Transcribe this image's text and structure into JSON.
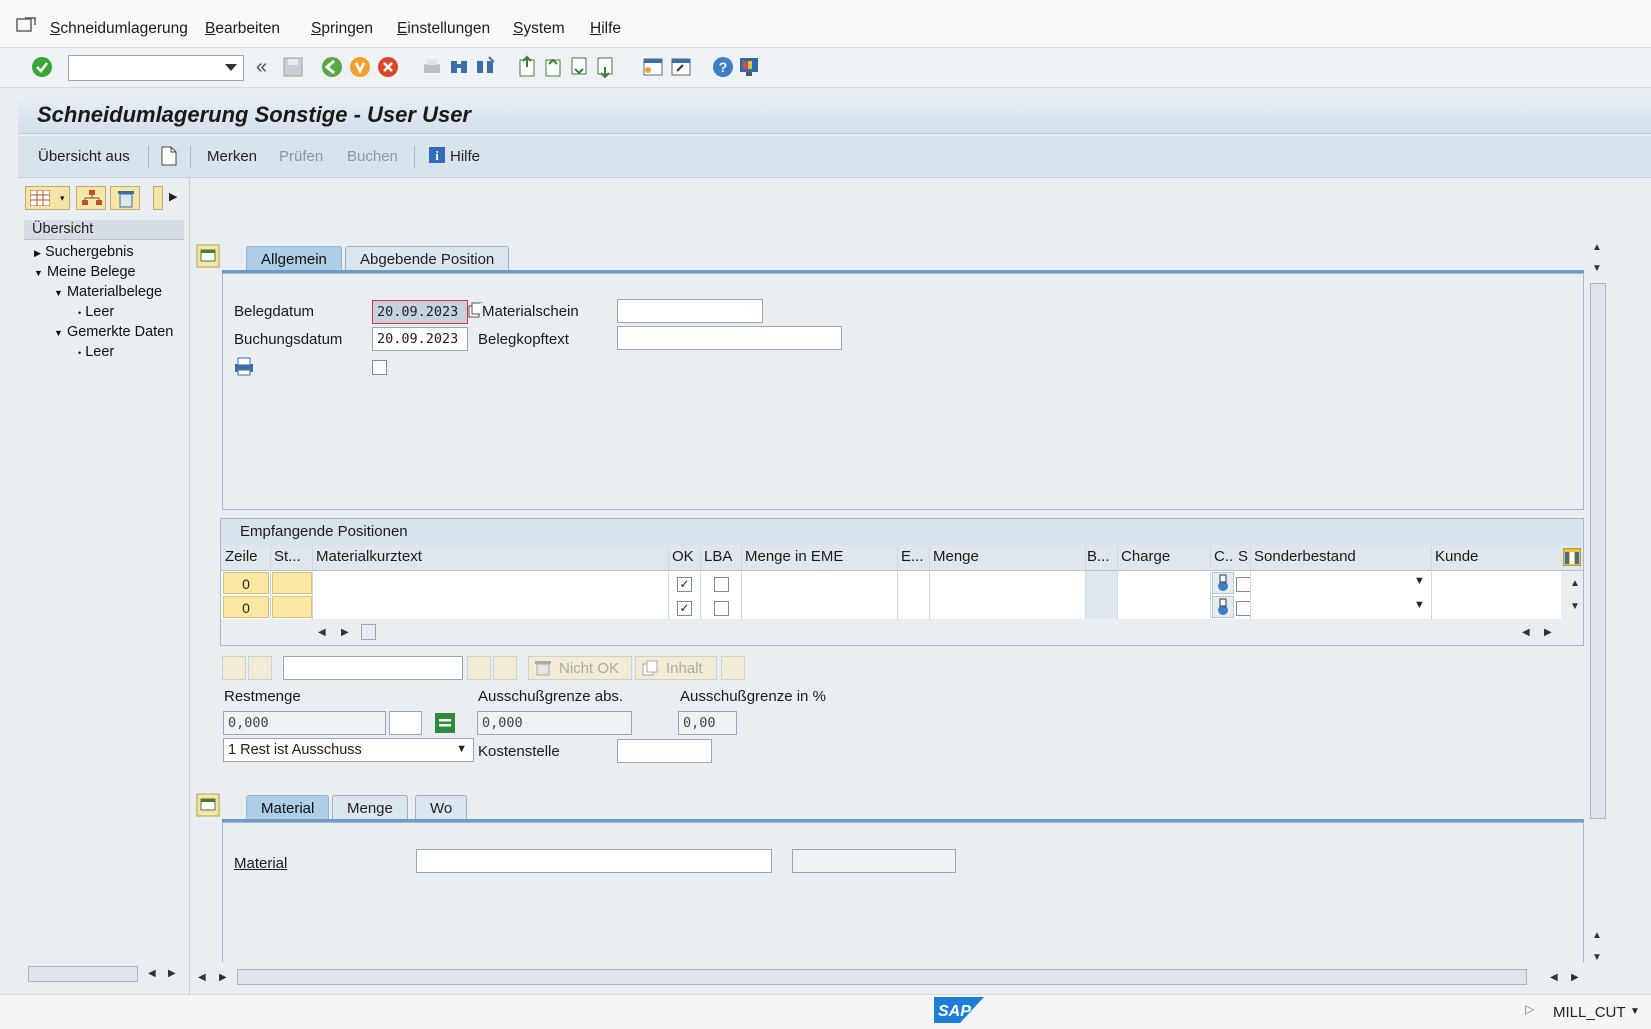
{
  "menubar": {
    "items": [
      {
        "label": "Schneidumlagerung",
        "ul": "S"
      },
      {
        "label": "Bearbeiten",
        "ul": "B"
      },
      {
        "label": "Springen",
        "ul": "S"
      },
      {
        "label": "Einstellungen",
        "ul": "E"
      },
      {
        "label": "System",
        "ul": "S"
      },
      {
        "label": "Hilfe",
        "ul": "H"
      }
    ]
  },
  "toolbar": {
    "command_field_value": ""
  },
  "title": "Schneidumlagerung Sonstige - User User",
  "app_toolbar": {
    "overview_off": "Übersicht aus",
    "remember": "Merken",
    "check": "Prüfen",
    "post": "Buchen",
    "help": "Hilfe"
  },
  "left_pane": {
    "header": "Übersicht",
    "tree": [
      {
        "label": "Suchergebnis",
        "level": 0,
        "arrow": "right"
      },
      {
        "label": "Meine Belege",
        "level": 0,
        "arrow": "down"
      },
      {
        "label": "Materialbelege",
        "level": 1,
        "arrow": "down"
      },
      {
        "label": "Leer",
        "level": 2,
        "arrow": "dot"
      },
      {
        "label": "Gemerkte Daten",
        "level": 1,
        "arrow": "down"
      },
      {
        "label": "Leer",
        "level": 2,
        "arrow": "dot"
      }
    ]
  },
  "header_tabs": {
    "general": "Allgemein",
    "giving_item": "Abgebende Position"
  },
  "header": {
    "doc_date_label": "Belegdatum",
    "doc_date_value": "20.09.2023",
    "posting_date_label": "Buchungsdatum",
    "posting_date_value": "20.09.2023",
    "material_slip_label": "Materialschein",
    "material_slip_value": "",
    "header_text_label": "Belegkopftext",
    "header_text_value": ""
  },
  "receiving": {
    "title": "Empfangende Positionen",
    "columns": [
      "Zeile",
      "St...",
      "Materialkurztext",
      "OK",
      "LBA",
      "Menge in EME",
      "E...",
      "Menge",
      "B...",
      "Charge",
      "C..",
      "S",
      "Sonderbestand",
      "Kunde"
    ],
    "rows": [
      {
        "line": "0",
        "ok": true,
        "lba": false
      },
      {
        "line": "0",
        "ok": true,
        "lba": false
      }
    ]
  },
  "lower_toolbar": {
    "not_ok": "Nicht OK",
    "content": "Inhalt"
  },
  "rest": {
    "rest_qty_label": "Restmenge",
    "rest_qty_value": "0,000",
    "scrap_abs_label": "Ausschußgrenze abs.",
    "scrap_abs_value": "0,000",
    "scrap_pct_label": "Ausschußgrenze in %",
    "scrap_pct_value": "0,00",
    "rest_option": "1 Rest ist Ausschuss",
    "cost_center_label": "Kostenstelle",
    "cost_center_value": ""
  },
  "detail_tabs": {
    "material": "Material",
    "quantity": "Menge",
    "where": "Wo"
  },
  "detail": {
    "material_label": "Material",
    "material_value": ""
  },
  "status": {
    "system": "MILL_CUT",
    "logo": "SAP"
  },
  "colors": {
    "accent": "#aecde6",
    "yellow": "#fbe8a2",
    "ok_green": "#3aa537",
    "cancel_red": "#d9472b"
  }
}
